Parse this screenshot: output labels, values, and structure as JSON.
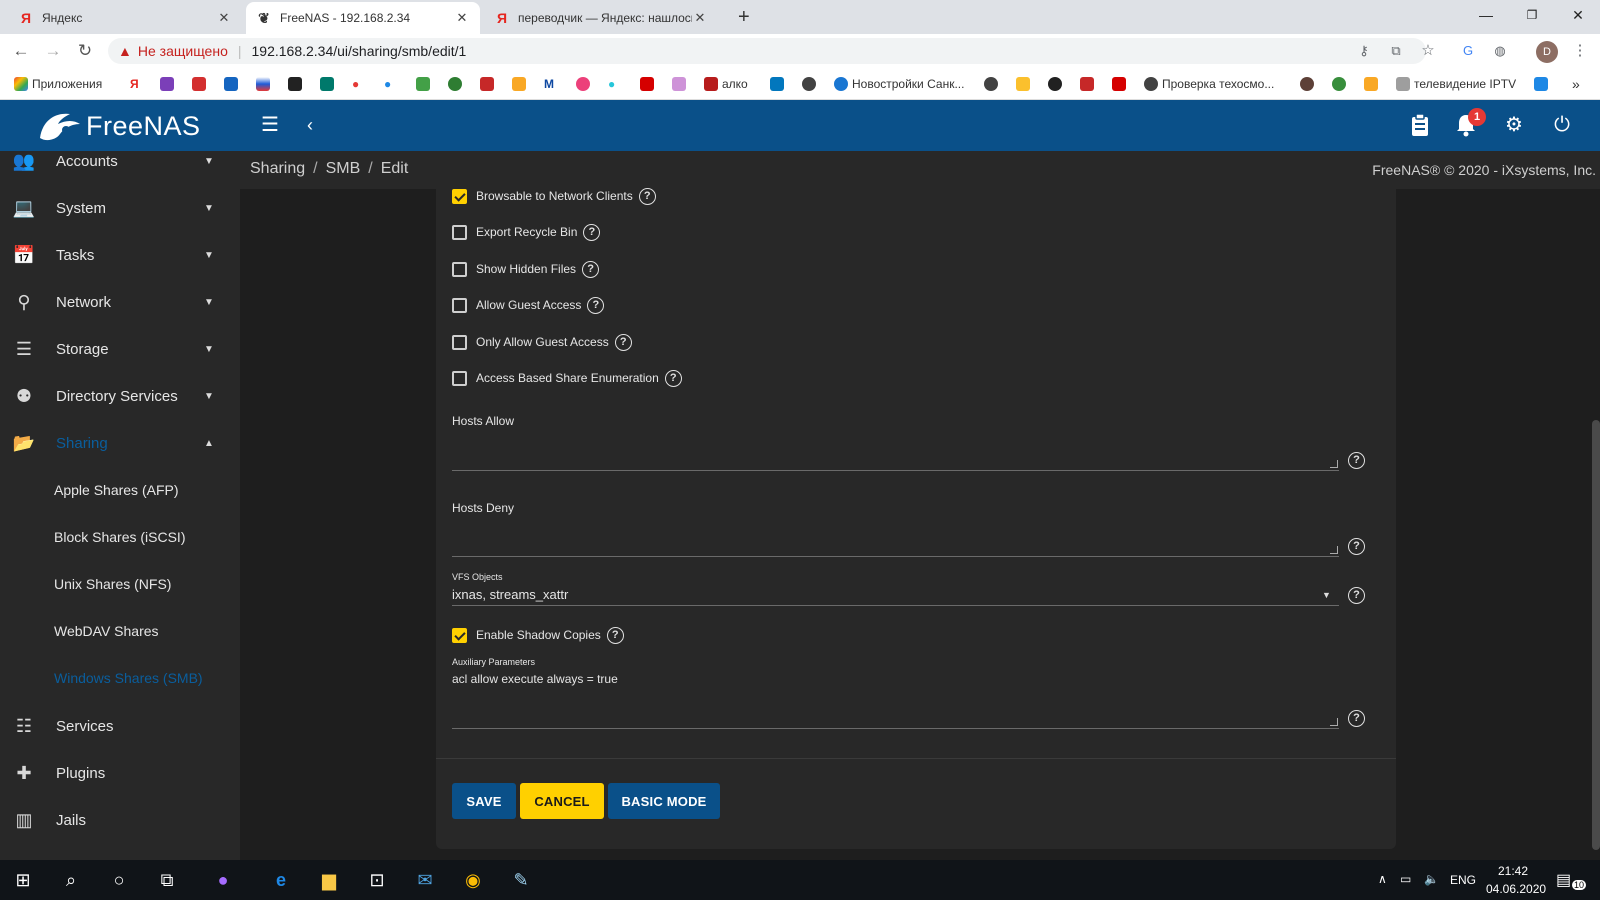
{
  "browser": {
    "tabs": [
      {
        "title": "Яндекс",
        "favicon": "yandex-icon",
        "active": false
      },
      {
        "title": "FreeNAS - 192.168.2.34",
        "favicon": "freenas-icon",
        "active": true
      },
      {
        "title": "переводчик — Яндекс: нашлось",
        "favicon": "yandex-icon",
        "active": false
      }
    ],
    "new_tab": "+",
    "security_label": "Не защищено",
    "url": "192.168.2.34/ui/sharing/smb/edit/1",
    "profile_initial": "D",
    "bookmarks": [
      "Приложения",
      "алко",
      "Новостройки Санк...",
      "Проверка техосмо...",
      "телевидение IPTV"
    ],
    "more_bookmarks": "»"
  },
  "app": {
    "logo_text": "FreeNAS",
    "notification_count": "1",
    "accent_color": "#0a5089",
    "warning_color": "#ffd000"
  },
  "sidebar": {
    "items": [
      {
        "label": "Accounts",
        "icon": "people-icon"
      },
      {
        "label": "System",
        "icon": "laptop-icon"
      },
      {
        "label": "Tasks",
        "icon": "calendar-icon"
      },
      {
        "label": "Network",
        "icon": "network-icon"
      },
      {
        "label": "Storage",
        "icon": "storage-icon"
      },
      {
        "label": "Directory Services",
        "icon": "directory-icon"
      },
      {
        "label": "Sharing",
        "icon": "folder-shared-icon"
      }
    ],
    "sharing_subitems": [
      "Apple Shares (AFP)",
      "Block Shares (iSCSI)",
      "Unix Shares (NFS)",
      "WebDAV Shares",
      "Windows Shares (SMB)"
    ],
    "bottom_items": [
      {
        "label": "Services",
        "icon": "tune-icon"
      },
      {
        "label": "Plugins",
        "icon": "puzzle-icon"
      },
      {
        "label": "Jails",
        "icon": "jail-icon"
      }
    ]
  },
  "breadcrumb": {
    "items": [
      "Sharing",
      "SMB",
      "Edit"
    ],
    "copyright": "FreeNAS® © 2020 - iXsystems, Inc."
  },
  "form": {
    "checkboxes": [
      {
        "label": "Browsable to Network Clients",
        "checked": true
      },
      {
        "label": "Export Recycle Bin",
        "checked": false
      },
      {
        "label": "Show Hidden Files",
        "checked": false
      },
      {
        "label": "Allow Guest Access",
        "checked": false
      },
      {
        "label": "Only Allow Guest Access",
        "checked": false
      },
      {
        "label": "Access Based Share Enumeration",
        "checked": false
      }
    ],
    "hosts_allow": {
      "label": "Hosts Allow",
      "value": ""
    },
    "hosts_deny": {
      "label": "Hosts Deny",
      "value": ""
    },
    "vfs_objects": {
      "label": "VFS Objects",
      "value": "ixnas, streams_xattr"
    },
    "shadow_copies": {
      "label": "Enable Shadow Copies",
      "checked": true
    },
    "aux_params": {
      "label": "Auxiliary Parameters",
      "value": "acl allow execute always = true"
    },
    "buttons": {
      "save": "SAVE",
      "cancel": "CANCEL",
      "basic_mode": "BASIC MODE"
    }
  },
  "taskbar": {
    "language": "ENG",
    "time": "21:42",
    "date": "04.06.2020",
    "notifications": "10"
  }
}
